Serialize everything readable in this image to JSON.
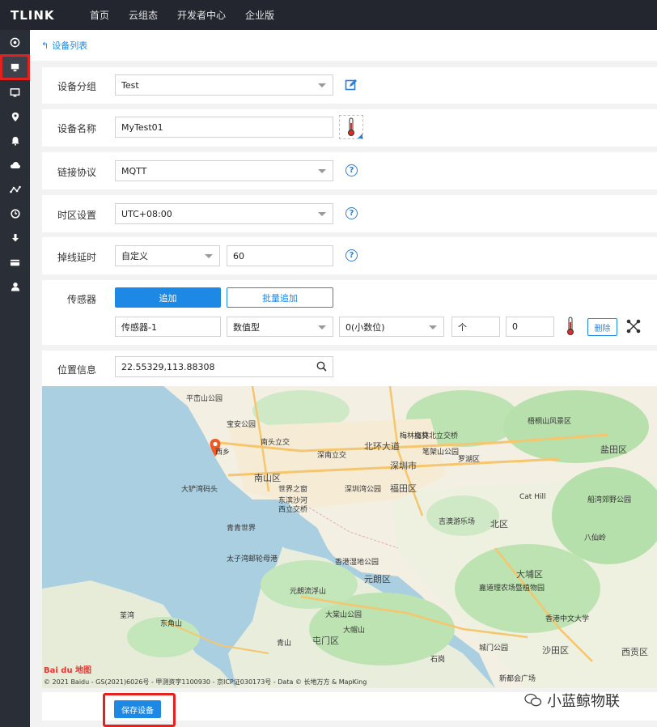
{
  "header": {
    "logo": "TLINK",
    "nav": [
      "首页",
      "云组态",
      "开发者中心",
      "企业版"
    ]
  },
  "sidebar": {
    "icons": [
      "dashboard-icon",
      "device-icon",
      "monitor-icon",
      "location-icon",
      "bell-icon",
      "cloud-icon",
      "share-icon",
      "clock-icon",
      "download-icon",
      "card-icon",
      "user-icon"
    ]
  },
  "breadcrumb": {
    "back_label": "设备列表"
  },
  "form": {
    "group": {
      "label": "设备分组",
      "value": "Test"
    },
    "name": {
      "label": "设备名称",
      "value": "MyTest01"
    },
    "protocol": {
      "label": "链接协议",
      "value": "MQTT"
    },
    "timezone": {
      "label": "时区设置",
      "value": "UTC+08:00"
    },
    "offline": {
      "label": "掉线延时",
      "mode": "自定义",
      "value": "60"
    },
    "sensors": {
      "label": "传感器",
      "add_label": "追加",
      "batch_add_label": "批量追加",
      "items": [
        {
          "name": "传感器-1",
          "type": "数值型",
          "decimal": "0(小数位)",
          "unit": "个",
          "value": "0",
          "delete_label": "删除"
        }
      ]
    },
    "location": {
      "label": "位置信息",
      "value": "22.55329,113.88308"
    }
  },
  "map": {
    "labels": [
      "平峦山公园",
      "宝安公园",
      "西乡",
      "南头立交",
      "深南立交",
      "北环大道",
      "深圳市",
      "南山区",
      "世界之窗",
      "深圳湾公园",
      "福田区",
      "东滨沙河",
      "西立交桥",
      "大铲湾码头",
      "青青世界",
      "太子湾邮轮母港",
      "香港湿地公园",
      "元朗区",
      "元朗流浮山",
      "屯门区",
      "东角山",
      "青山",
      "大棠山公园",
      "大帽山",
      "石岗",
      "城门公园",
      "新都会广场",
      "沙田区",
      "西贡区",
      "大埔区",
      "香港中文大学",
      "嘉道理农场暨植物园",
      "罗湖区",
      "梅林立交",
      "笔架山公园",
      "梧桐山风景区",
      "盐田区",
      "北区",
      "Cat Hill",
      "八仙岭",
      "船湾郊野公园",
      "吉澳游乐场",
      "荃湾",
      "梅林北立交桥"
    ],
    "copyright": "© 2021 Baidu - GS(2021)6026号 - 甲测资字1100930 - 京ICP证030173号 - Data © 长地万方 & MapKing",
    "logo": "Bai du 地图"
  },
  "footer": {
    "save_label": "保存设备"
  },
  "watermark": "小蓝鲸物联"
}
